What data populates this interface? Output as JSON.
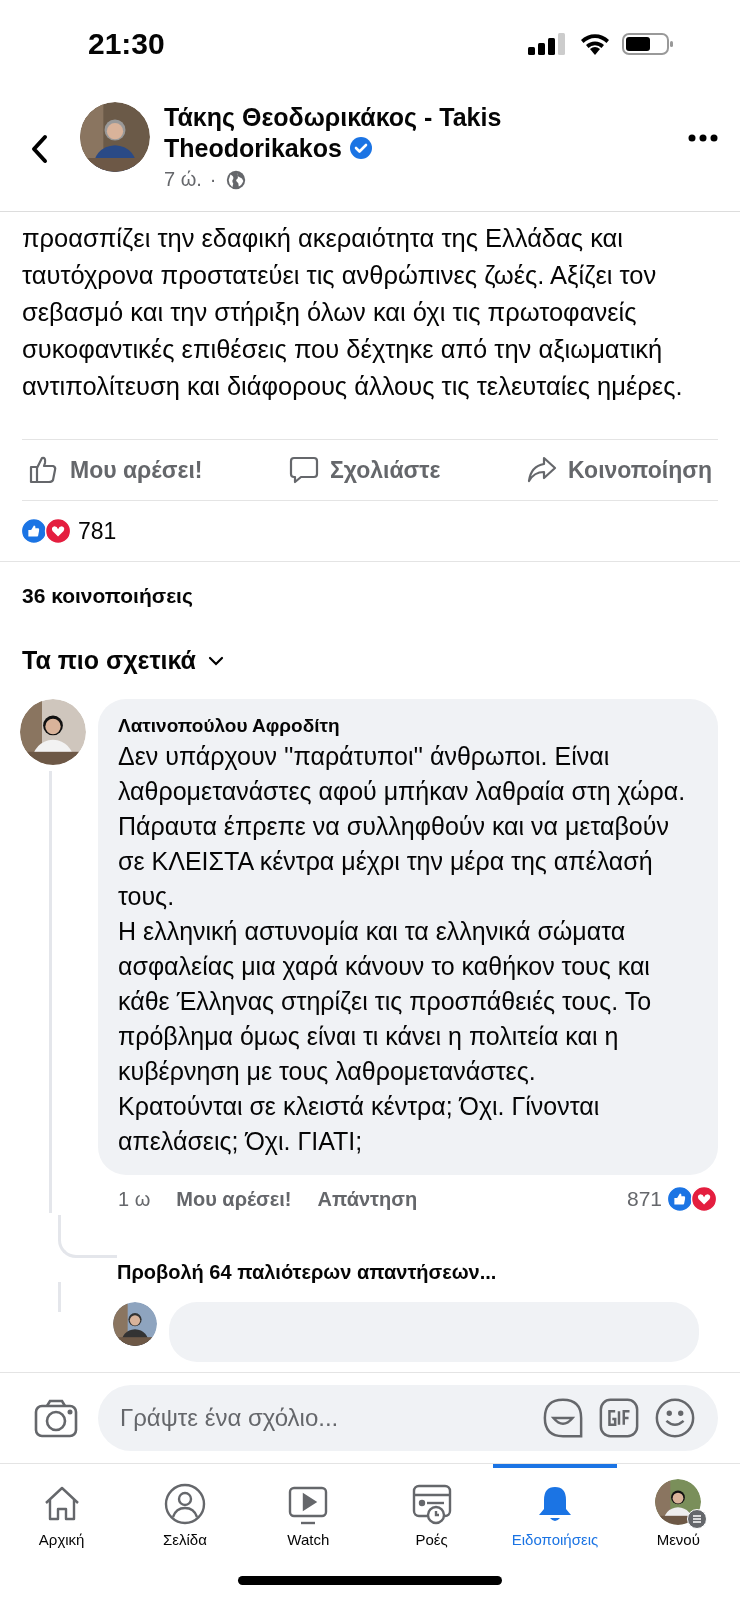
{
  "status_bar": {
    "time": "21:30"
  },
  "header": {
    "name": "Τάκης Θεοδωρικάκος - Takis Theodorikakos",
    "verified": true,
    "time": "7 ώ.",
    "separator": "·"
  },
  "post": {
    "text": "προασπίζει την εδαφική ακεραιότητα της Ελλάδας και ταυτόχρονα προστατεύει τις ανθρώπινες ζωές. Αξίζει τον σεβασμό και την στήριξη όλων και όχι τις πρωτοφανείς συκοφαντικές επιθέσεις που δέχτηκε από την αξιωματική αντιπολίτευση και διάφορους άλλους τις τελευταίες ημέρες."
  },
  "actions": [
    {
      "kind": "like",
      "label": "Μου αρέσει!"
    },
    {
      "kind": "comment",
      "label": "Σχολιάστε"
    },
    {
      "kind": "share",
      "label": "Κοινοποίηση"
    }
  ],
  "reactions": {
    "count": "781"
  },
  "shares": "36 κοινοποιήσεις",
  "sort": {
    "label": "Τα πιο σχετικά"
  },
  "comments": [
    {
      "author": "Λατινοπούλου Αφροδίτη",
      "text": "Δεν υπάρχουν ''παράτυποι'' άνθρωποι. Είναι λαθρομετανάστες αφού μπήκαν λαθραία στη χώρα. Πάραυτα έπρεπε να συλληφθούν και να μεταβούν σε ΚΛΕΙΣΤΑ κέντρα μέχρι την μέρα της απέλασή τους.\nΗ ελληνική αστυνομία και τα ελληνικά σώματα ασφαλείας μια χαρά κάνουν το καθήκον τους και κάθε Έλληνας στηρίζει τις προσπάθειές τους. Το πρόβλημα όμως είναι τι κάνει η πολιτεία και η κυβέρνηση με τους λαθρομετανάστες.\nΚρατούνται σε κλειστά κέντρα; Όχι. Γίνονται απελάσεις; Όχι. ΓΙΑΤΙ;",
      "time": "1 ω",
      "like": "Μου αρέσει!",
      "reply": "Απάντηση",
      "reaction_count": "871"
    }
  ],
  "more_replies": "Προβολή 64 παλιότερων απαντήσεων...",
  "composer": {
    "placeholder": "Γράψτε ένα σχόλιο..."
  },
  "nav": [
    {
      "kind": "home",
      "label": "Αρχική",
      "selected": false
    },
    {
      "kind": "page",
      "label": "Σελίδα",
      "selected": false
    },
    {
      "kind": "watch",
      "label": "Watch",
      "selected": false
    },
    {
      "kind": "feeds",
      "label": "Ροές",
      "selected": false
    },
    {
      "kind": "bell",
      "label": "Ειδοποιήσεις",
      "selected": true
    },
    {
      "kind": "menu",
      "label": "Μενού",
      "selected": false
    }
  ]
}
